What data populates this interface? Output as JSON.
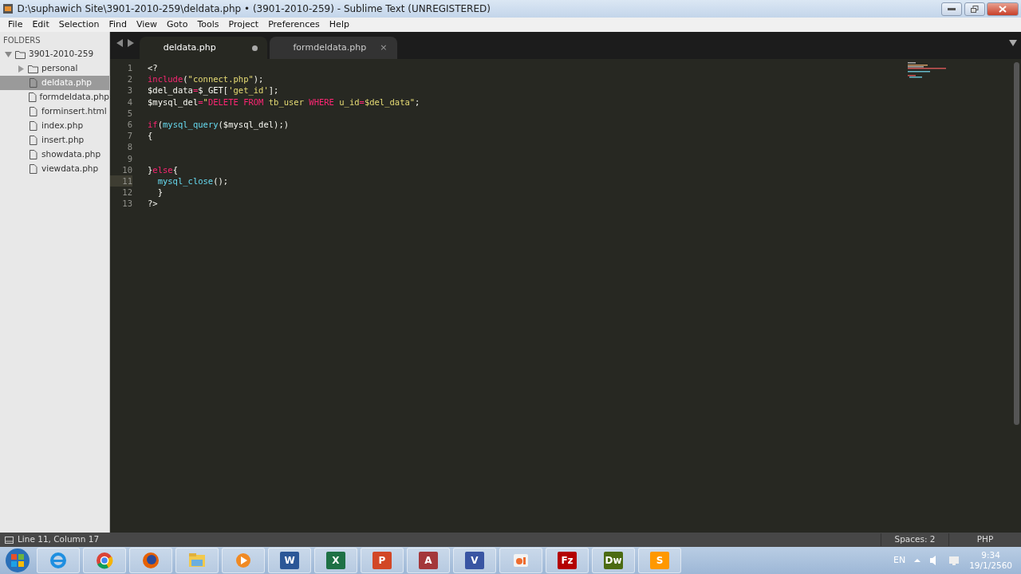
{
  "window": {
    "title": "D:\\suphawich Site\\3901-2010-259\\deldata.php • (3901-2010-259) - Sublime Text (UNREGISTERED)"
  },
  "menu": [
    "File",
    "Edit",
    "Selection",
    "Find",
    "View",
    "Goto",
    "Tools",
    "Project",
    "Preferences",
    "Help"
  ],
  "sidebar": {
    "heading": "FOLDERS",
    "items": [
      {
        "label": "3901-2010-259",
        "kind": "folder",
        "expanded": true,
        "selected": false,
        "children": [
          {
            "label": "personal",
            "kind": "folder",
            "expanded": false,
            "selected": false
          },
          {
            "label": "deldata.php",
            "kind": "file",
            "selected": true
          },
          {
            "label": "formdeldata.php",
            "kind": "file",
            "selected": false
          },
          {
            "label": "forminsert.html",
            "kind": "file",
            "selected": false
          },
          {
            "label": "index.php",
            "kind": "file",
            "selected": false
          },
          {
            "label": "insert.php",
            "kind": "file",
            "selected": false
          },
          {
            "label": "showdata.php",
            "kind": "file",
            "selected": false
          },
          {
            "label": "viewdata.php",
            "kind": "file",
            "selected": false
          }
        ]
      }
    ]
  },
  "tabs": [
    {
      "label": "deldata.php",
      "selected": true,
      "modified": true
    },
    {
      "label": "formdeldata.php",
      "selected": false,
      "modified": false,
      "close": "×"
    }
  ],
  "editor": {
    "lines": [
      {
        "number": "1",
        "current": false,
        "tokens": [
          {
            "text": "<?",
            "kind": "plain"
          }
        ]
      },
      {
        "number": "2",
        "current": false,
        "tokens": [
          {
            "text": "include",
            "kind": "kw"
          },
          {
            "text": "(",
            "kind": "plain"
          },
          {
            "text": "\"connect.php\"",
            "kind": "str"
          },
          {
            "text": ");",
            "kind": "plain"
          }
        ]
      },
      {
        "number": "3",
        "current": false,
        "tokens": [
          {
            "text": "$del_data",
            "kind": "plain"
          },
          {
            "text": "=",
            "kind": "kw"
          },
          {
            "text": "$_GET[",
            "kind": "plain"
          },
          {
            "text": "'get_id'",
            "kind": "str"
          },
          {
            "text": "];",
            "kind": "plain"
          }
        ]
      },
      {
        "number": "4",
        "current": false,
        "tokens": [
          {
            "text": "$mysql_del",
            "kind": "plain"
          },
          {
            "text": "=",
            "kind": "kw"
          },
          {
            "text": "\"",
            "kind": "str"
          },
          {
            "text": "DELETE FROM",
            "kind": "kw"
          },
          {
            "text": " tb_user ",
            "kind": "str"
          },
          {
            "text": "WHERE",
            "kind": "kw"
          },
          {
            "text": " u_id",
            "kind": "str"
          },
          {
            "text": "=",
            "kind": "kw"
          },
          {
            "text": "$del_data\"",
            "kind": "str"
          },
          {
            "text": ";",
            "kind": "plain"
          }
        ]
      },
      {
        "number": "5",
        "current": false
      },
      {
        "number": "6",
        "current": false,
        "tokens": [
          {
            "text": "if",
            "kind": "kw"
          },
          {
            "text": "(",
            "kind": "plain"
          },
          {
            "text": "mysql_query",
            "kind": "fn"
          },
          {
            "text": "($mysql_del);)",
            "kind": "plain"
          }
        ]
      },
      {
        "number": "7",
        "current": false,
        "tokens": [
          {
            "text": "{",
            "kind": "plain"
          }
        ]
      },
      {
        "number": "8",
        "current": false
      },
      {
        "number": "9",
        "current": false
      },
      {
        "number": "10",
        "current": false,
        "tokens": [
          {
            "text": "}",
            "kind": "plain"
          },
          {
            "text": "else",
            "kind": "kw"
          },
          {
            "text": "{",
            "kind": "plain"
          }
        ]
      },
      {
        "number": "11",
        "current": true,
        "tokens": [
          {
            "text": "  mysql_close",
            "kind": "fn"
          },
          {
            "text": "();",
            "kind": "plain"
          }
        ]
      },
      {
        "number": "12",
        "current": false,
        "tokens": [
          {
            "text": "  }",
            "kind": "plain"
          }
        ]
      },
      {
        "number": "13",
        "current": false,
        "tokens": [
          {
            "text": "?>",
            "kind": "plain"
          }
        ]
      }
    ]
  },
  "status_bar": {
    "position": "Line 11, Column 17",
    "indentation": "Spaces: 2",
    "syntax": "PHP"
  },
  "taskbar": {
    "apps": [
      {
        "kind": "ie"
      },
      {
        "kind": "chrome"
      },
      {
        "kind": "firefox"
      },
      {
        "kind": "explorer"
      },
      {
        "kind": "media"
      },
      {
        "kind": "letter",
        "label": "W",
        "color": "#2b5797"
      },
      {
        "kind": "letter",
        "label": "X",
        "color": "#1e7145"
      },
      {
        "kind": "letter",
        "label": "P",
        "color": "#d24726"
      },
      {
        "kind": "letter",
        "label": "A",
        "color": "#a4373a"
      },
      {
        "kind": "letter",
        "label": "V",
        "color": "#3955a3"
      },
      {
        "kind": "ppt"
      },
      {
        "kind": "letter",
        "label": "Fz",
        "color": "#b40000"
      },
      {
        "kind": "letter",
        "label": "Dw",
        "color": "#4b6b12"
      },
      {
        "kind": "letter",
        "label": "S",
        "color": "#ff9800"
      }
    ],
    "language": "EN",
    "time": "9:34",
    "date": "19/1/2560"
  }
}
